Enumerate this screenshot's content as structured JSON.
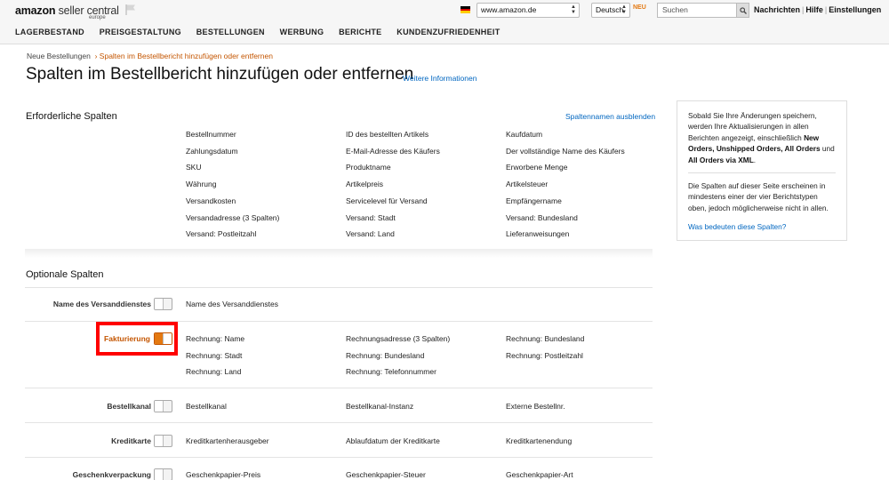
{
  "header": {
    "logo_brand": "amazon",
    "logo_product": "seller central",
    "logo_region": "europe",
    "marketplace": "www.amazon.de",
    "language": "Deutsch",
    "language_badge": "NEU",
    "search_placeholder": "Suchen",
    "links": [
      "Nachrichten",
      "Hilfe",
      "Einstellungen"
    ],
    "nav": [
      "LAGERBESTAND",
      "PREISGESTALTUNG",
      "BESTELLUNGEN",
      "WERBUNG",
      "BERICHTE",
      "KUNDENZUFRIEDENHEIT"
    ],
    "flag_colors": [
      "#000000",
      "#dd0000",
      "#ffce00"
    ]
  },
  "breadcrumb": {
    "parent": "Neue Bestellungen",
    "separator": "›",
    "current": "Spalten im Bestellbericht hinzufügen oder entfernen"
  },
  "page": {
    "title": "Spalten im Bestellbericht hinzufügen oder entfernen",
    "more_link": "Weitere Informationen"
  },
  "required": {
    "heading": "Erforderliche Spalten",
    "hide_link": "Spaltennamen ausblenden",
    "rows": [
      [
        "Bestellnummer",
        "ID des bestellten Artikels",
        "Kaufdatum"
      ],
      [
        "Zahlungsdatum",
        "E-Mail-Adresse des Käufers",
        "Der vollständige Name des Käufers"
      ],
      [
        "SKU",
        "Produktname",
        "Erworbene Menge"
      ],
      [
        "Währung",
        "Artikelpreis",
        "Artikelsteuer"
      ],
      [
        "Versandkosten",
        "Servicelevel für Versand",
        "Empfängername"
      ],
      [
        "Versandadresse (3 Spalten)",
        "Versand: Stadt",
        "Versand: Bundesland"
      ],
      [
        "Versand: Postleitzahl",
        "Versand: Land",
        "Lieferanweisungen"
      ]
    ]
  },
  "optional": {
    "heading": "Optionale Spalten",
    "groups": [
      {
        "label": "Name des Versanddienstes",
        "enabled": false,
        "rows": [
          [
            "Name des Versanddienstes",
            "",
            ""
          ]
        ]
      },
      {
        "label": "Fakturierung",
        "enabled": true,
        "rows": [
          [
            "Rechnung: Name",
            "Rechnungsadresse (3 Spalten)",
            "Rechnung: Bundesland"
          ],
          [
            "Rechnung: Stadt",
            "Rechnung: Bundesland",
            "Rechnung: Postleitzahl"
          ],
          [
            "Rechnung: Land",
            "Rechnung: Telefonnummer",
            ""
          ]
        ]
      },
      {
        "label": "Bestellkanal",
        "enabled": false,
        "rows": [
          [
            "Bestellkanal",
            "Bestellkanal-Instanz",
            "Externe Bestellnr."
          ]
        ]
      },
      {
        "label": "Kreditkarte",
        "enabled": false,
        "rows": [
          [
            "Kreditkartenherausgeber",
            "Ablaufdatum der Kreditkarte",
            "Kreditkartenendung"
          ]
        ]
      },
      {
        "label": "Geschenkverpackung",
        "enabled": false,
        "rows": [
          [
            "Geschenkpapier-Preis",
            "Geschenkpapier-Steuer",
            "Geschenkpapier-Art"
          ]
        ]
      }
    ]
  },
  "panel": {
    "p1_pre": "Sobald Sie Ihre Änderungen speichern, werden Ihre Aktualisierungen in allen Berichten angezeigt, einschließlich ",
    "p1_b1": "New Orders, Unshipped Orders, All Orders",
    "p1_mid": " und ",
    "p1_b2": "All Orders via XML",
    "p1_end": ".",
    "p2": "Die Spalten auf dieser Seite erscheinen in mindestens einer der vier Berichtstypen oben, jedoch möglicherweise nicht in allen.",
    "link": "Was bedeuten diese Spalten?"
  }
}
